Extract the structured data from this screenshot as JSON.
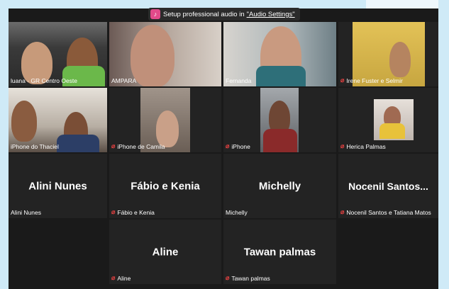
{
  "banner": {
    "icon": "music-note-icon",
    "text": "Setup professional audio in",
    "link": "\"Audio Settings\""
  },
  "tiles": [
    {
      "name": "luana - GR Centro Oeste",
      "muted": false
    },
    {
      "name": "AMPARA",
      "muted": false
    },
    {
      "name": "Fernanda",
      "muted": false,
      "active": true
    },
    {
      "name": "Irene Fuster e Selmir",
      "muted": true
    },
    {
      "name": "iPhone do Thaciel",
      "muted": false
    },
    {
      "name": "iPhone de Camila",
      "muted": true
    },
    {
      "name": "iPhone",
      "muted": true
    },
    {
      "name": "Herica Palmas",
      "muted": true
    },
    {
      "name": "Alini Nunes",
      "display": "Alini Nunes",
      "muted": false
    },
    {
      "name": "Fábio e Kenia",
      "display": "Fábio e Kenia",
      "muted": true
    },
    {
      "name": "Michelly",
      "display": "Michelly",
      "muted": false
    },
    {
      "name": "Nocenil Santos e Tatiana Matos",
      "display": "Nocenil  Santos...",
      "muted": true
    },
    {
      "name": "Aline",
      "display": "Aline",
      "muted": true
    },
    {
      "name": "Tawan palmas",
      "display": "Tawan palmas",
      "muted": true
    }
  ],
  "colors": {
    "active_border": "#b9e36b",
    "mute": "#e04040",
    "tile_bg": "#232323"
  }
}
